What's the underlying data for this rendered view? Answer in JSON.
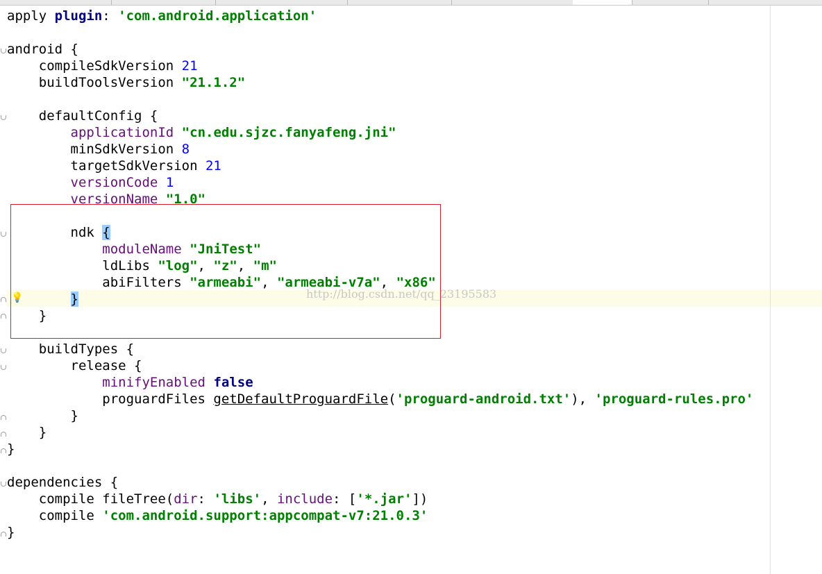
{
  "watermark": "http://blog.csdn.net/qq_23195583",
  "editor": {
    "l1": {
      "a": "apply ",
      "b": "plugin",
      "c": ": ",
      "d": "'com.android.application'"
    },
    "l3": {
      "a": "android {"
    },
    "l4": {
      "a": "    compileSdkVersion ",
      "b": "21"
    },
    "l5": {
      "a": "    buildToolsVersion ",
      "b": "\"21.1.2\""
    },
    "l7": {
      "a": "    defaultConfig {"
    },
    "l8": {
      "a": "        ",
      "b": "applicationId",
      "c": " ",
      "d": "\"cn.edu.sjzc.fanyafeng.jni\""
    },
    "l9": {
      "a": "        minSdkVersion ",
      "b": "8"
    },
    "l10": {
      "a": "        targetSdkVersion ",
      "b": "21"
    },
    "l11": {
      "a": "        ",
      "b": "versionCode",
      "c": " ",
      "d": "1"
    },
    "l12": {
      "a": "        ",
      "b": "versionName",
      "c": " ",
      "d": "\"1.0\""
    },
    "l14": {
      "a": "        ndk ",
      "b": "{"
    },
    "l15": {
      "a": "            ",
      "b": "moduleName",
      "c": " ",
      "d": "\"JniTest\""
    },
    "l16": {
      "a": "            ldLibs ",
      "b": "\"log\"",
      "c": ", ",
      "d": "\"z\"",
      "e": ", ",
      "f": "\"m\""
    },
    "l17": {
      "a": "            abiFilters ",
      "b": "\"armeabi\"",
      "c": ", ",
      "d": "\"armeabi-v7a\"",
      "e": ", ",
      "f": "\"x86\""
    },
    "l18": {
      "a": "        ",
      "b": "}"
    },
    "l19": {
      "a": "    }"
    },
    "l21": {
      "a": "    buildTypes {"
    },
    "l22": {
      "a": "        release {"
    },
    "l23": {
      "a": "            ",
      "b": "minifyEnabled",
      "c": " ",
      "d": "false"
    },
    "l24": {
      "a": "            proguardFiles ",
      "b": "getDefaultProguardFile",
      "c": "(",
      "d": "'proguard-android.txt'",
      "e": "), ",
      "f": "'proguard-rules.pro'"
    },
    "l25": {
      "a": "        }"
    },
    "l26": {
      "a": "    }"
    },
    "l27": {
      "a": "}"
    },
    "l29": {
      "a": "dependencies {"
    },
    "l30": {
      "a": "    compile fileTree(",
      "b": "dir",
      "c": ": ",
      "d": "'libs'",
      "e": ", ",
      "f": "include",
      "g": ": [",
      "h": "'*.jar'",
      "i": "])"
    },
    "l31": {
      "a": "    compile ",
      "b": "'com.android.support:appcompat-v7:21.0.3'"
    },
    "l32": {
      "a": "}"
    }
  }
}
